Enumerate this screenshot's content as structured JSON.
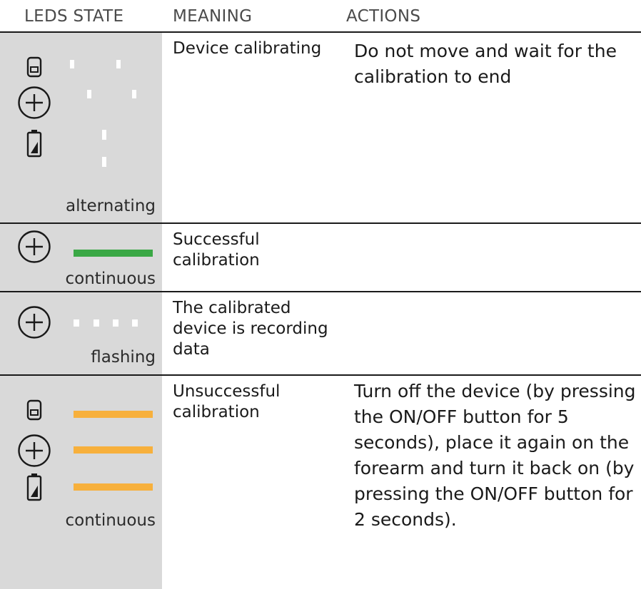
{
  "header": {
    "leds_state": "LEDS STATE",
    "meaning": "MEANING",
    "actions": "ACTIONS"
  },
  "rows": [
    {
      "mode": "alternating",
      "meaning": "Device calibrating",
      "actions": "Do not move and wait for the calibration to end",
      "icons": [
        "sd-card-icon",
        "plus-circle-icon",
        "battery-icon"
      ],
      "led_color": "#ffffff"
    },
    {
      "mode": "continuous",
      "meaning": "Successful calibration",
      "actions": "",
      "icons": [
        "plus-circle-icon"
      ],
      "led_color": "#3aa845"
    },
    {
      "mode": "flashing",
      "meaning": "The calibrated device is recording data",
      "actions": "",
      "icons": [
        "plus-circle-icon"
      ],
      "led_color": "#ffffff"
    },
    {
      "mode": "continuous",
      "meaning": "Unsuccessful calibration",
      "actions": "Turn off the device (by pressing the ON/OFF button for 5 seconds), place it again on the forearm and turn it back on (by pressing the ON/OFF button for 2 seconds).",
      "icons": [
        "sd-card-icon",
        "plus-circle-icon",
        "battery-icon"
      ],
      "led_color": "#f7b03c"
    }
  ]
}
